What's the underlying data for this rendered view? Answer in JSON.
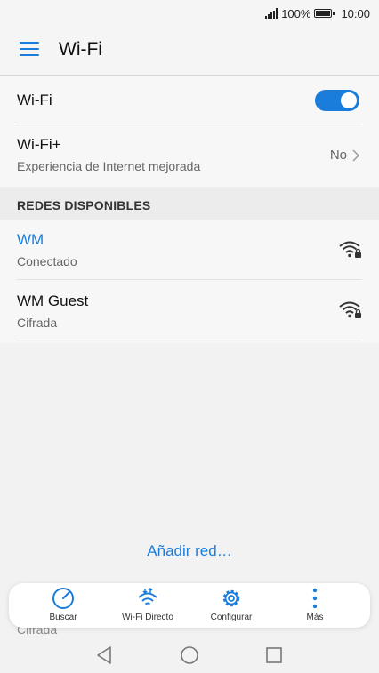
{
  "status_bar": {
    "battery": "100%",
    "time": "10:00"
  },
  "header": {
    "title": "Wi-Fi",
    "menu_icon": "menu-icon"
  },
  "wifi": {
    "label": "Wi-Fi",
    "enabled": true,
    "accent": "#1a7ddb"
  },
  "wifi_plus": {
    "label": "Wi-Fi+",
    "subtitle": "Experiencia de Internet mejorada",
    "value": "No"
  },
  "section": {
    "available_networks": "REDES DISPONIBLES"
  },
  "networks": [
    {
      "name": "WM",
      "status": "Conectado",
      "connected": true,
      "icon": "wifi-lock-icon"
    },
    {
      "name": "WM Guest",
      "status": "Cifrada",
      "connected": false,
      "icon": "wifi-lock-icon"
    }
  ],
  "add_network": "Añadir red…",
  "ghost_text": "Cifrada",
  "toolbar": {
    "items": [
      {
        "label": "Buscar",
        "icon": "scan-icon"
      },
      {
        "label": "Wi-Fi Directo",
        "icon": "wifi-direct-icon"
      },
      {
        "label": "Configurar",
        "icon": "settings-gear-icon"
      },
      {
        "label": "Más",
        "icon": "more-vertical-icon"
      }
    ]
  },
  "nav": {
    "back_icon": "back-icon",
    "home_icon": "home-icon",
    "recents_icon": "recents-icon"
  }
}
